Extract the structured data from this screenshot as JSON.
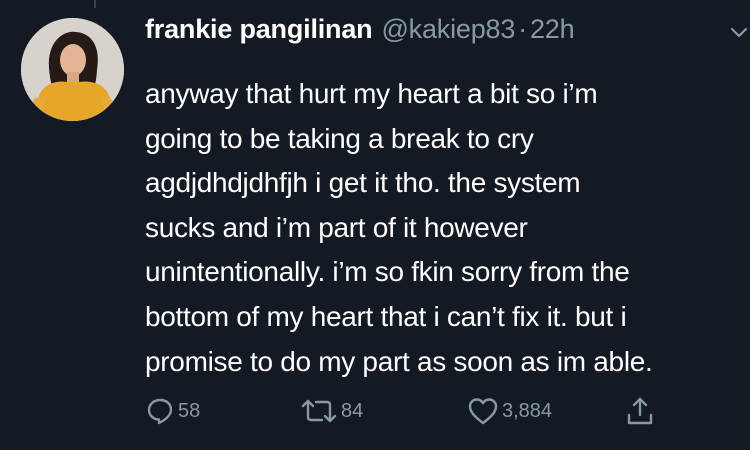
{
  "tweet": {
    "display_name": "frankie pangilinan",
    "handle": "@kakiep83",
    "separator": "·",
    "time": "22h",
    "lines": [
      "anyway that hurt my heart a bit so i’m",
      "going to be taking a break to cry",
      "agdjdhdjdhfjh i get it tho. the system",
      "sucks and i’m part of it however",
      "unintentionally. i’m so fkin sorry from the",
      "bottom of my heart that i can’t fix it. but i",
      "promise to do my part as soon as im able."
    ],
    "actions": {
      "reply_count": "58",
      "retweet_count": "84",
      "like_count": "3,884"
    }
  },
  "colors": {
    "background": "#131a24",
    "text": "#ffffff",
    "secondary": "#8899a6"
  },
  "icons": [
    "avatar",
    "chevron-down-icon",
    "reply-icon",
    "retweet-icon",
    "like-icon",
    "share-icon"
  ]
}
